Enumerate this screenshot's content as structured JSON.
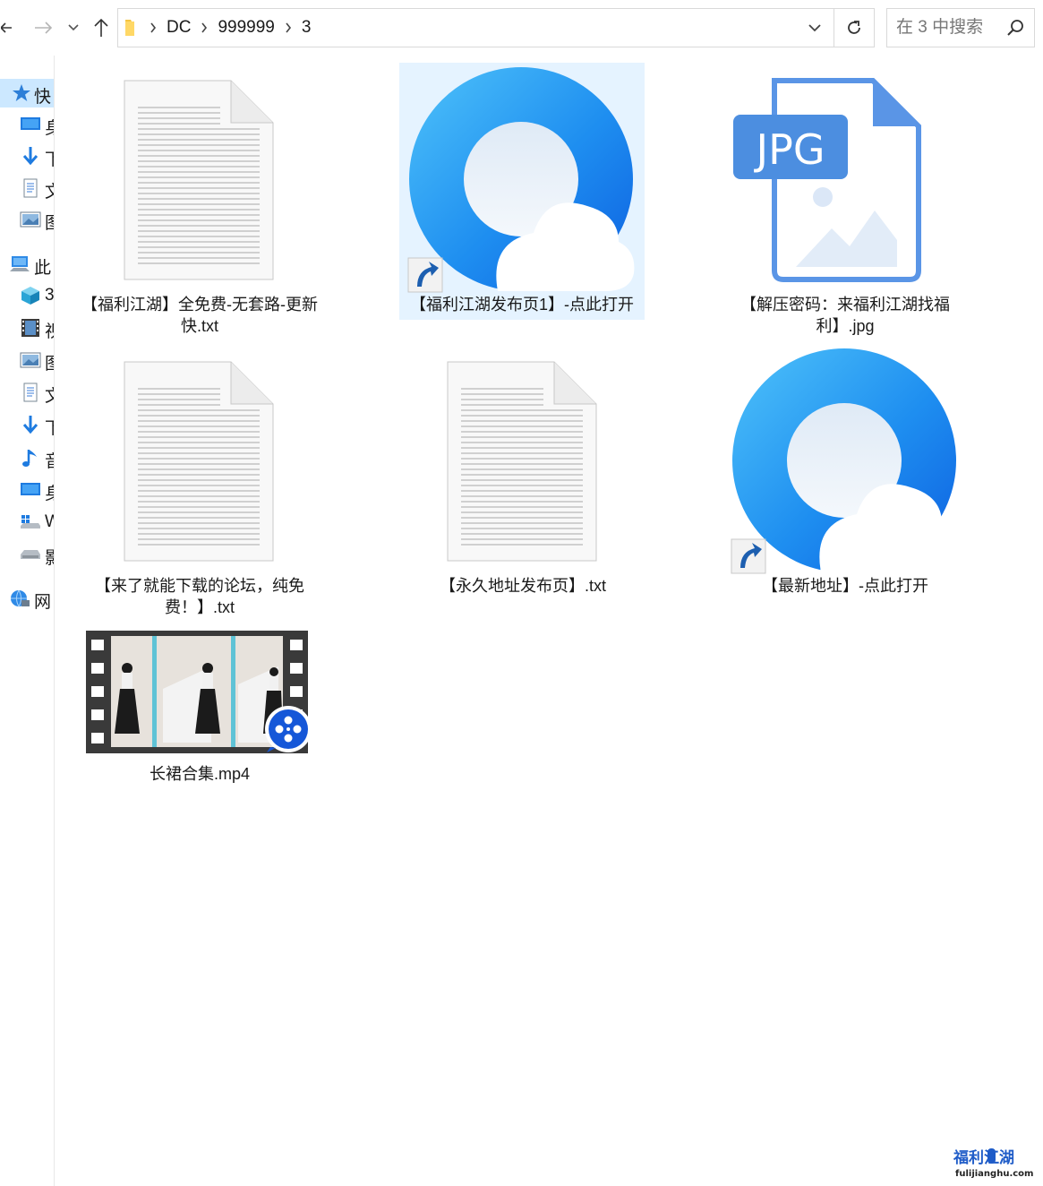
{
  "toolbar": {
    "breadcrumb": [
      "DC",
      "999999",
      "3"
    ],
    "search_placeholder": "在 3 中搜索"
  },
  "sidebar": {
    "items": [
      {
        "label": "快",
        "icon": "star-icon",
        "selected": true
      },
      {
        "label": "身",
        "icon": "desktop-icon"
      },
      {
        "label": "下",
        "icon": "download-icon"
      },
      {
        "label": "文",
        "icon": "document-icon"
      },
      {
        "label": "图",
        "icon": "picture-icon"
      },
      {
        "label": "此",
        "icon": "computer-icon"
      },
      {
        "label": "3",
        "icon": "cube-3d-icon"
      },
      {
        "label": "视",
        "icon": "video-icon"
      },
      {
        "label": "图",
        "icon": "picture-icon"
      },
      {
        "label": "文",
        "icon": "document-icon"
      },
      {
        "label": "下",
        "icon": "download-icon"
      },
      {
        "label": "音",
        "icon": "music-icon"
      },
      {
        "label": "身",
        "icon": "desktop-icon"
      },
      {
        "label": "W",
        "icon": "windows-drive-icon"
      },
      {
        "label": "影",
        "icon": "drive-icon"
      },
      {
        "label": "网",
        "icon": "network-icon"
      }
    ]
  },
  "files": [
    {
      "name": "【福利江湖】全免费-无套路-更新快.txt",
      "icon": "text-file-icon"
    },
    {
      "name": "【福利江湖发布页1】-点此打开",
      "icon": "qq-browser-shortcut-icon",
      "selected": true
    },
    {
      "name": "【解压密码：来福利江湖找福利】.jpg",
      "icon": "jpg-file-icon",
      "badge": "JPG"
    },
    {
      "name": "【来了就能下载的论坛，纯免费！】.txt",
      "icon": "text-file-icon"
    },
    {
      "name": "【永久地址发布页】.txt",
      "icon": "text-file-icon"
    },
    {
      "name": "【最新地址】-点此打开",
      "icon": "qq-browser-shortcut-icon"
    },
    {
      "name": "长裙合集.mp4",
      "icon": "video-thumbnail-icon"
    }
  ],
  "watermark": {
    "title": "福利江湖",
    "url": "fulijianghu.com"
  },
  "colors": {
    "accent": "#0078d7",
    "selection": "#e5f3ff",
    "jpg_blue": "#4c8ee0"
  }
}
